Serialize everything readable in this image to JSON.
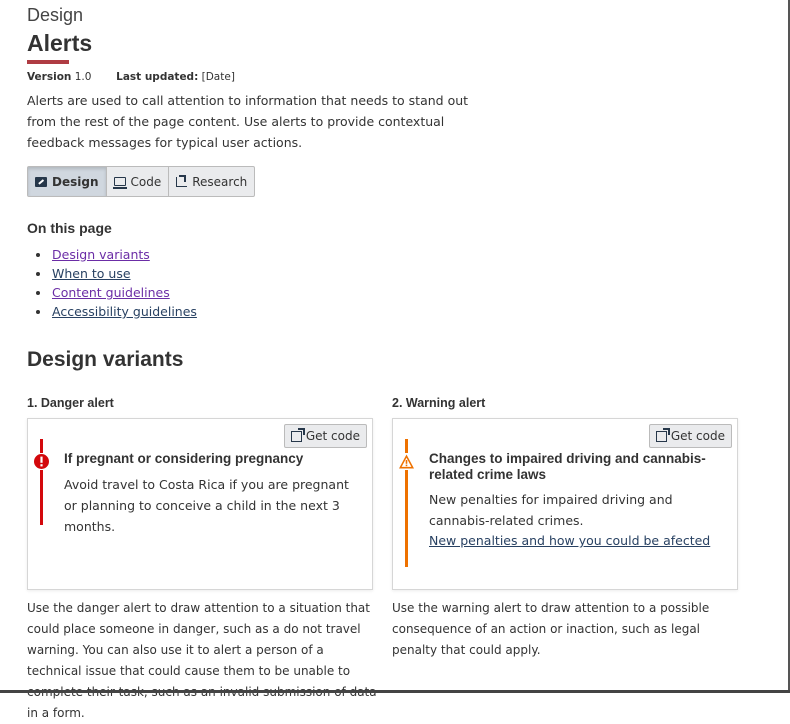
{
  "header": {
    "eyebrow": "Design",
    "title": "Alerts",
    "version_label": "Version",
    "version_value": "1.0",
    "updated_label": "Last updated:",
    "updated_value": "[Date]",
    "intro": "Alerts are used to call attention to information that needs to stand out from the rest of the page content. Use alerts to provide contextual feedback messages for typical user actions."
  },
  "tabs": [
    {
      "label": "Design",
      "icon": "edit-square-icon",
      "active": true
    },
    {
      "label": "Code",
      "icon": "laptop-icon",
      "active": false
    },
    {
      "label": "Research",
      "icon": "research-icon",
      "active": false
    }
  ],
  "on_this_page": {
    "heading": "On this page",
    "links": [
      "Design variants",
      "When to use",
      "Content guidelines",
      "Accessibility guidelines"
    ]
  },
  "design_variants": {
    "heading": "Design variants",
    "get_code_label": "Get code",
    "variants": [
      {
        "title": "1. Danger alert",
        "type": "danger",
        "color": "#d3080c",
        "alert_heading": "If pregnant or considering pregnancy",
        "alert_body": "Avoid travel to Costa Rica if you are pregnant or planning to conceive a child in the next 3 months.",
        "description": "Use the danger alert to draw attention to a situation that could place someone in danger, such as a do not travel warning. You can also use it to alert a person of a technical issue that could cause them to be unable to complete their task, such as an invalid submission of data in a form."
      },
      {
        "title": "2. Warning alert",
        "type": "warning",
        "color": "#ee7100",
        "alert_heading": "Changes to impaired driving and cannabis-related crime laws",
        "alert_body": "New penalties for impaired driving and cannabis-related crimes.",
        "alert_link": "New penalties and how you could be afected",
        "description": "Use the warning alert to draw attention to a possible consequence of an action or inaction, such as legal penalty that could apply."
      }
    ]
  },
  "colors": {
    "accent_rule": "#af3c43",
    "link_visited": "#6b2da6",
    "link": "#284162"
  }
}
